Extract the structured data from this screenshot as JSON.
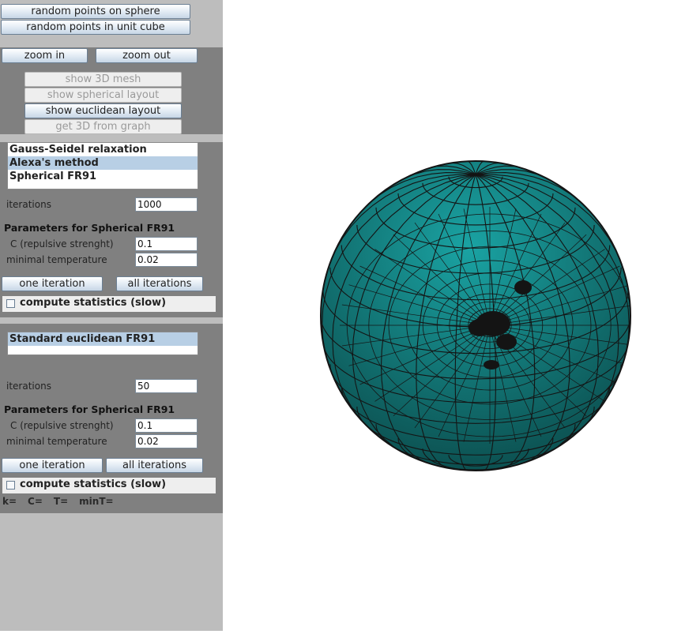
{
  "top_buttons": {
    "random_sphere": "random points on sphere",
    "random_cube": "random points in unit cube"
  },
  "view_buttons": {
    "zoom_in": "zoom in",
    "zoom_out": "zoom out",
    "show_3d_mesh": "show 3D mesh",
    "show_spherical": "show spherical layout",
    "show_euclidean": "show euclidean layout",
    "get_3d": "get 3D from graph"
  },
  "spherical_panel": {
    "methods": [
      "Gauss-Seidel relaxation",
      "Alexa's method",
      "Spherical FR91"
    ],
    "selected_index": 1,
    "iterations_label": "iterations",
    "iterations_value": "1000",
    "params_header": "Parameters for Spherical FR91",
    "c_label": "C (repulsive strenght)",
    "c_value": "0.1",
    "min_temp_label": "minimal temperature",
    "min_temp_value": "0.02",
    "one_iteration": "one iteration",
    "all_iterations": "all iterations",
    "compute_stats": "compute statistics (slow)",
    "compute_stats_checked": false
  },
  "euclidean_panel": {
    "methods": [
      "Standard euclidean FR91"
    ],
    "selected_index": 0,
    "iterations_label": "iterations",
    "iterations_value": "50",
    "params_header": "Parameters for Spherical FR91",
    "c_label": "C (repulsive strenght)",
    "c_value": "0.1",
    "min_temp_label": "minimal temperature",
    "min_temp_value": "0.02",
    "one_iteration": "one iteration",
    "all_iterations": "all iterations",
    "compute_stats": "compute statistics (slow)",
    "compute_stats_checked": false,
    "stats": {
      "k": "k=",
      "c": "C=",
      "t": "T=",
      "mint": "minT="
    }
  },
  "colors": {
    "sphere_light": "#1aa3a3",
    "sphere_dark": "#0b4a4a",
    "mesh_line": "#141414",
    "panel_bg": "#808080",
    "sidebar_bg": "#bdbdbd"
  }
}
